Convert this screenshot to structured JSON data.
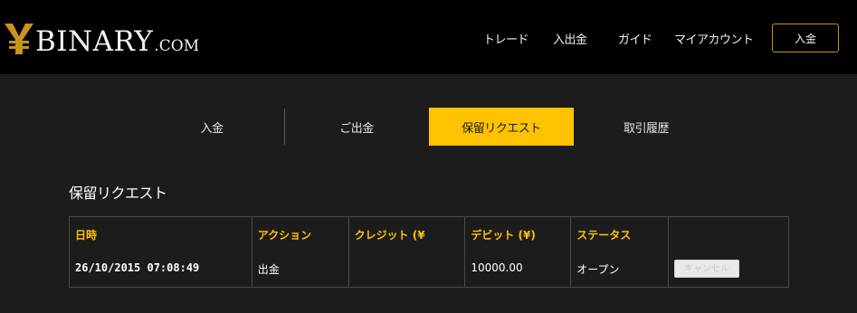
{
  "brand": {
    "name": "BINARY",
    "suffix": ".COM"
  },
  "nav": {
    "items": [
      {
        "label": "トレード"
      },
      {
        "label": "入出金"
      },
      {
        "label": "ガイド"
      },
      {
        "label": "マイアカウント"
      }
    ],
    "deposit_label": "入金"
  },
  "tabs": [
    {
      "label": "入金"
    },
    {
      "label": "ご出金"
    },
    {
      "label": "保留リクエスト"
    },
    {
      "label": "取引履歴"
    }
  ],
  "section": {
    "title": "保留リクエスト"
  },
  "table": {
    "headers": [
      "日時",
      "アクション",
      "クレジット (¥",
      "デビット (¥)",
      "ステータス",
      ""
    ],
    "rows": [
      {
        "datetime": "26/10/2015 07:08:49",
        "action": "出金",
        "credit": "",
        "debit": "10000.00",
        "status": "オープン",
        "cancel_label": "キャンセル"
      }
    ]
  },
  "colors": {
    "accent": "#ffc200",
    "header_bg": "#000000",
    "page_bg": "#1c1c1c",
    "button_border": "#c9931c"
  }
}
